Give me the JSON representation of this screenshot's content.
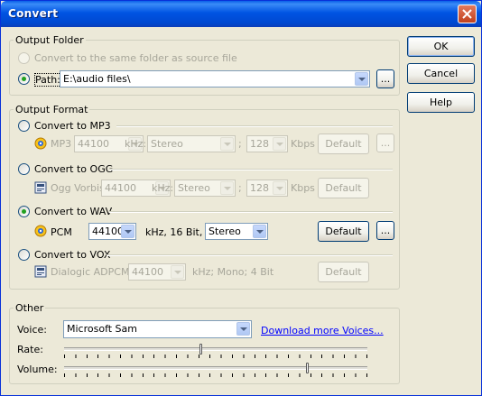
{
  "window": {
    "title": "Convert"
  },
  "buttons": {
    "ok": "OK",
    "cancel": "Cancel",
    "help": "Help",
    "browse": "..."
  },
  "output_folder": {
    "label": "Output Folder",
    "same_folder": "Convert to the same folder as source file",
    "path_label": "Path:",
    "path_value": "E:\\audio files\\"
  },
  "output_format": {
    "label": "Output Format",
    "mp3": {
      "label": "Convert to MP3",
      "codec": "MP3",
      "rate": "44100",
      "khz": "kHz:",
      "channels": "Stereo",
      "sep": ";",
      "bitrate": "128",
      "unit": "Kbps",
      "default": "Default"
    },
    "ogg": {
      "label": "Convert to OGG",
      "codec": "Ogg Vorbis",
      "rate": "44100",
      "khz": "kHz:",
      "channels": "Stereo",
      "sep": ";",
      "bitrate": "128",
      "unit": "Kbps",
      "default": "Default"
    },
    "wav": {
      "label": "Convert to WAV",
      "codec": "PCM",
      "rate": "44100",
      "khz": "kHz, 16 Bit,",
      "channels": "Stereo",
      "default": "Default"
    },
    "vox": {
      "label": "Convert to VOX",
      "codec": "Dialogic ADPCM",
      "rate": "44100",
      "info": "kHz; Mono; 4 Bit",
      "default": "Default"
    }
  },
  "other": {
    "label": "Other",
    "voice_label": "Voice:",
    "voice_value": "Microsoft Sam",
    "download_link": "Download more Voices...",
    "rate_label": "Rate:",
    "rate_value": 0.45,
    "volume_label": "Volume:",
    "volume_value": 0.8
  },
  "selected_format": "wav",
  "selected_output": "path"
}
